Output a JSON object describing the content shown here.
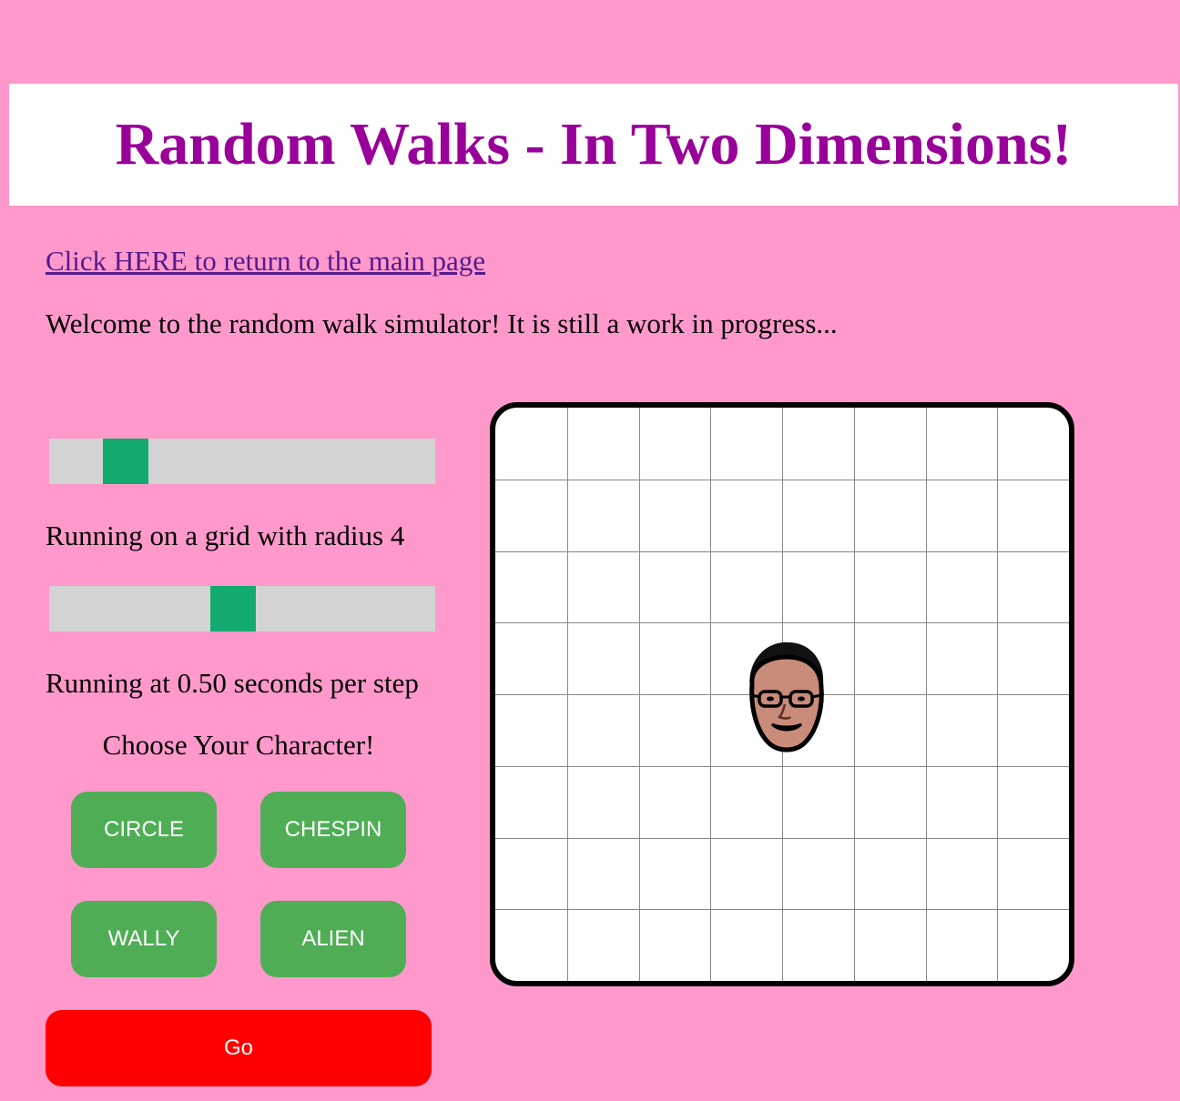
{
  "header": {
    "title": "Random Walks - In Two Dimensions!"
  },
  "nav": {
    "main_page_link": "Click HERE to return to the main page"
  },
  "intro": {
    "welcome_text": "Welcome to the random walk simulator! It is still a work in progress..."
  },
  "controls": {
    "radius_slider": {
      "value": 4,
      "min": 1,
      "max": 20
    },
    "radius_text": "Running on a grid with radius 4",
    "speed_slider": {
      "value": 0.5,
      "min": 0.05,
      "max": 1
    },
    "speed_text": "Running at 0.50 seconds per step",
    "choose_title": "Choose Your Character!",
    "characters": {
      "circle": "Circle",
      "chespin": "Chespin",
      "wally": "Wally",
      "alien": "Alien"
    },
    "go_label": "Go"
  },
  "grid": {
    "radius": 4,
    "walker_position": {
      "x": 0,
      "y": 0
    },
    "selected_character": "face"
  },
  "colors": {
    "background": "#ff99cc",
    "title": "#990099",
    "link": "#551a8b",
    "slider_track": "#d3d3d3",
    "slider_thumb": "#12aa6e",
    "character_button": "#4fae55",
    "go_button": "#ff0000"
  }
}
